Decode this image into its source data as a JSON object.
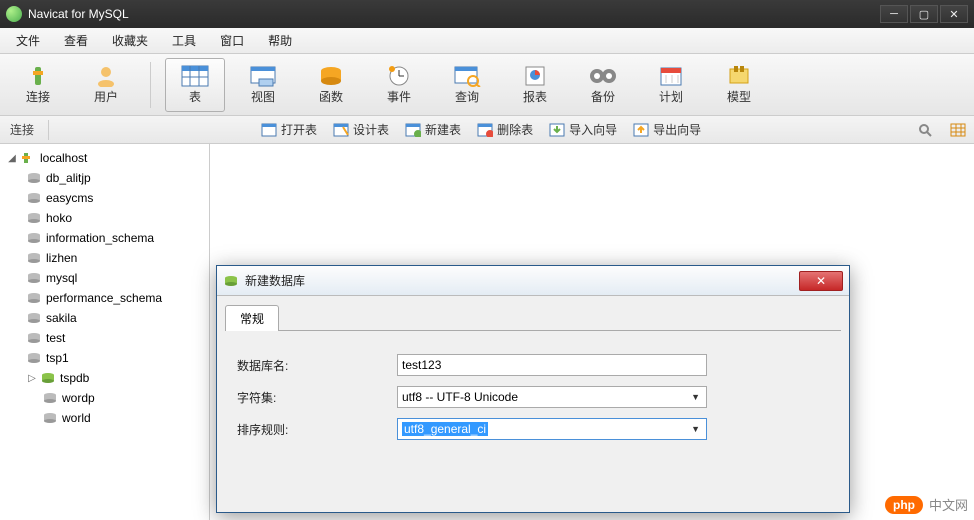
{
  "titlebar": {
    "title": "Navicat for MySQL"
  },
  "menu": {
    "file": "文件",
    "view": "查看",
    "fav": "收藏夹",
    "tools": "工具",
    "window": "窗口",
    "help": "帮助"
  },
  "toolbar": {
    "connect": "连接",
    "user": "用户",
    "table": "表",
    "viewbtn": "视图",
    "func": "函数",
    "event": "事件",
    "query": "查询",
    "report": "报表",
    "backup": "备份",
    "plan": "计划",
    "model": "模型"
  },
  "subbar": {
    "label": "连接",
    "open": "打开表",
    "design": "设计表",
    "new": "新建表",
    "delete": "删除表",
    "import": "导入向导",
    "export": "导出向导"
  },
  "tree": {
    "root": "localhost",
    "items": [
      "db_alitjp",
      "easycms",
      "hoko",
      "information_schema",
      "lizhen",
      "mysql",
      "performance_schema",
      "sakila",
      "test",
      "tsp1",
      "tspdb",
      "wordp",
      "world"
    ]
  },
  "dialog": {
    "title": "新建数据库",
    "tab": "常规",
    "name_label": "数据库名:",
    "name_value": "test123",
    "charset_label": "字符集:",
    "charset_value": "utf8 -- UTF-8 Unicode",
    "collation_label": "排序规则:",
    "collation_value": "utf8_general_ci"
  },
  "watermark": {
    "badge": "php",
    "text": "中文网"
  }
}
